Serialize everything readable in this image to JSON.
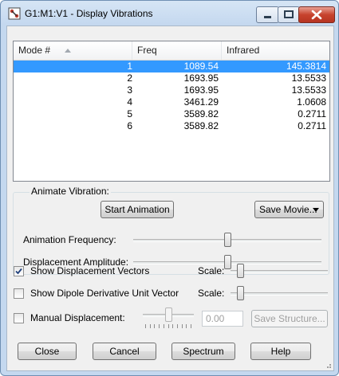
{
  "window": {
    "title": "G1:M1:V1 - Display Vibrations"
  },
  "table": {
    "columns": [
      "Mode #",
      "Freq",
      "Infrared"
    ],
    "rows": [
      {
        "mode": "1",
        "freq": "1089.54",
        "ir": "145.3814",
        "selected": true
      },
      {
        "mode": "2",
        "freq": "1693.95",
        "ir": "13.5533",
        "selected": false
      },
      {
        "mode": "3",
        "freq": "1693.95",
        "ir": "13.5533",
        "selected": false
      },
      {
        "mode": "4",
        "freq": "3461.29",
        "ir": "1.0608",
        "selected": false
      },
      {
        "mode": "5",
        "freq": "3589.82",
        "ir": "0.2711",
        "selected": false
      },
      {
        "mode": "6",
        "freq": "3589.82",
        "ir": "0.2711",
        "selected": false
      }
    ]
  },
  "animate": {
    "group_label": "Animate Vibration:",
    "start_label": "Start Animation",
    "save_movie_label": "Save Movie...",
    "frequency_label": "Animation Frequency:",
    "frequency_level": 0.5,
    "amplitude_label": "Displacement Amplitude:",
    "amplitude_level": 0.5
  },
  "options": {
    "show_vectors": {
      "label": "Show Displacement Vectors",
      "checked": true,
      "scale_label": "Scale:",
      "scale_level": 0.1
    },
    "show_dipole": {
      "label": "Show Dipole Derivative Unit Vector",
      "checked": false,
      "scale_label": "Scale:",
      "scale_level": 0.1
    },
    "manual": {
      "label": "Manual Displacement:",
      "checked": false,
      "value": "0.00",
      "save_structure_label": "Save Structure...",
      "level": 0.5
    }
  },
  "buttons": {
    "close": "Close",
    "cancel": "Cancel",
    "spectrum": "Spectrum",
    "help": "Help"
  },
  "colors": {
    "selection": "#3399ff",
    "client_bg": "#f0f0f0",
    "close_button": "#c7432d"
  }
}
